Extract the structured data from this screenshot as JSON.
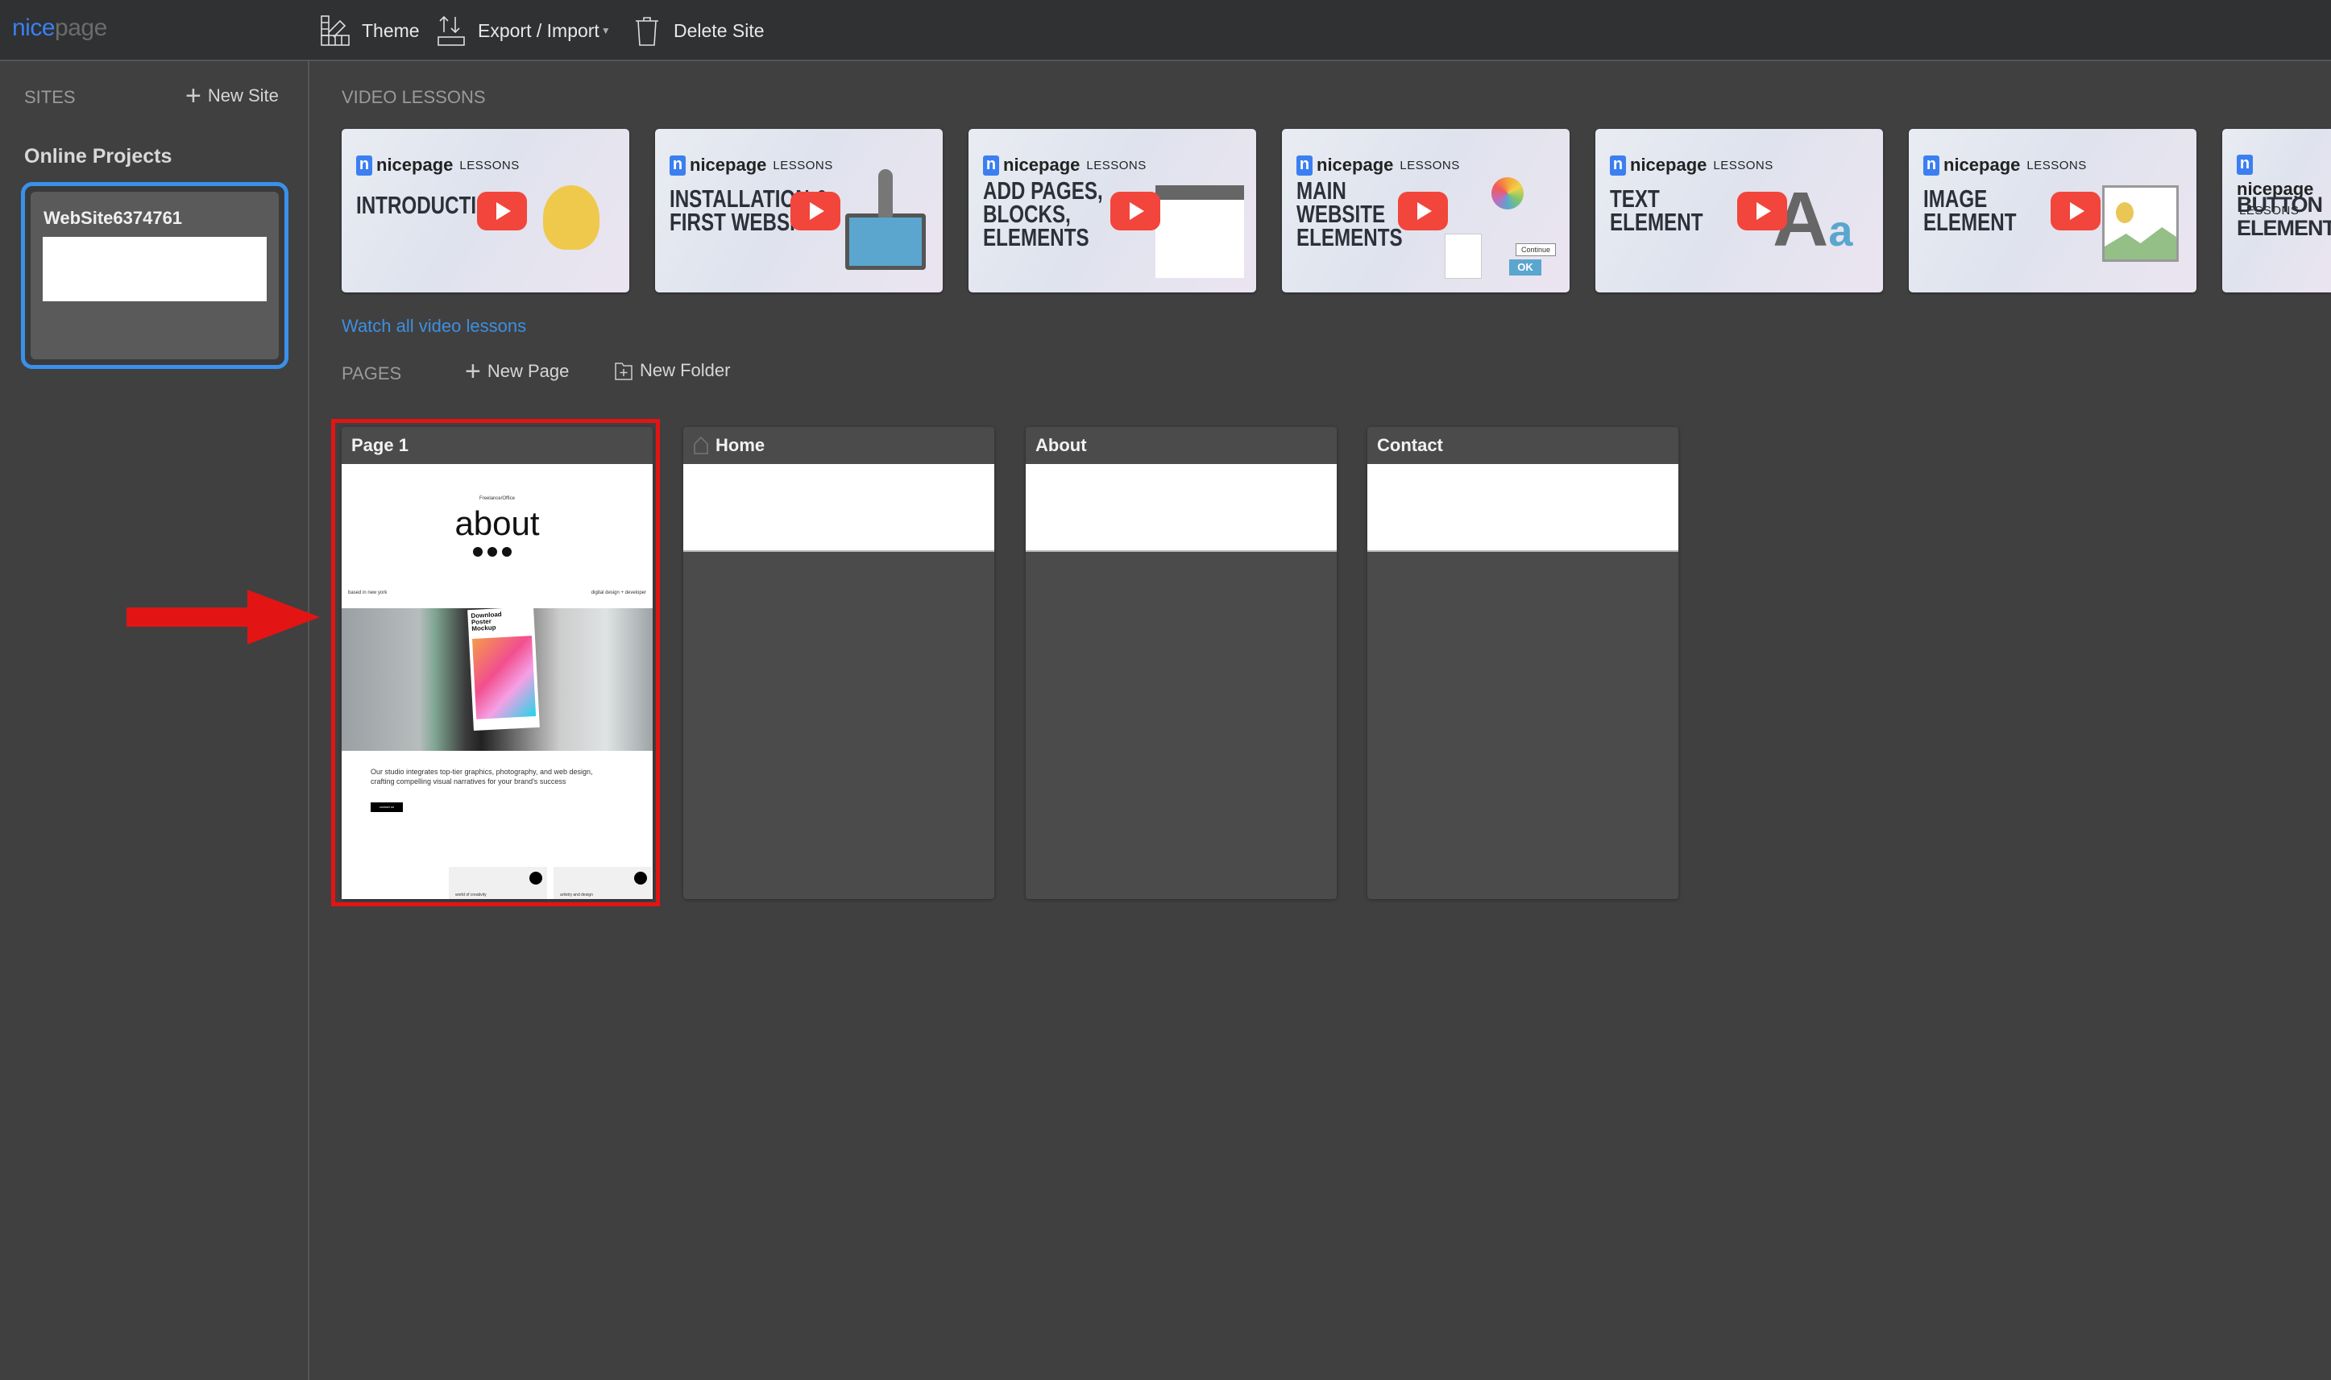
{
  "app": {
    "logo_a": "nice",
    "logo_b": "page"
  },
  "toolbar": {
    "theme": "Theme",
    "export_import": "Export / Import",
    "delete_site": "Delete Site"
  },
  "sidebar": {
    "sites_label": "SITES",
    "new_site": "New Site",
    "online_projects": "Online Projects",
    "site_name": "WebSite6374761"
  },
  "video": {
    "section_label": "VIDEO LESSONS",
    "brand": "nicepage",
    "lessons": "LESSONS",
    "watch_all": "Watch all video lessons",
    "cards": [
      {
        "title": [
          "INTRODUCTION"
        ],
        "icon": "lightbulb-icon"
      },
      {
        "title": [
          "INSTALLATION &",
          "FIRST WEBSITE"
        ],
        "icon": "rocket-laptop-icon"
      },
      {
        "title": [
          "ADD PAGES,",
          "BLOCKS,",
          "ELEMENTS"
        ],
        "icon": "add-panel-icon"
      },
      {
        "title": [
          "MAIN",
          "WEBSITE",
          "ELEMENTS"
        ],
        "icon": "elements-icon",
        "extra": [
          "Continue",
          "OK"
        ]
      },
      {
        "title": [
          "TEXT",
          "ELEMENT"
        ],
        "icon": "text-aa-icon",
        "extra": [
          "A",
          "a"
        ]
      },
      {
        "title": [
          "IMAGE",
          "ELEMENT"
        ],
        "icon": "image-icon"
      },
      {
        "title": [
          "BUTTON",
          "ELEMENT"
        ],
        "icon": "button-icon"
      }
    ]
  },
  "pages": {
    "section_label": "PAGES",
    "new_page": "New Page",
    "new_folder": "New Folder",
    "items": [
      {
        "name": "Page 1",
        "selected": true
      },
      {
        "name": "Home",
        "home": true
      },
      {
        "name": "About"
      },
      {
        "name": "Contact"
      }
    ],
    "preview": {
      "tagline": "Freelance/Office",
      "heading": "about",
      "left_note": "based in new york",
      "right_note": "digital design + developer",
      "poster": "Download Poster Mockup",
      "paragraph": "Our studio integrates top-tier graphics, photography, and web design, crafting compelling visual narratives for your brand's success",
      "button": "contact us",
      "tile1": "world of creativity",
      "tile2": "artistry and design"
    }
  },
  "colors": {
    "accent": "#3a90ea",
    "highlight": "#e31414",
    "topbar": "#2f3133",
    "background": "#404040"
  }
}
